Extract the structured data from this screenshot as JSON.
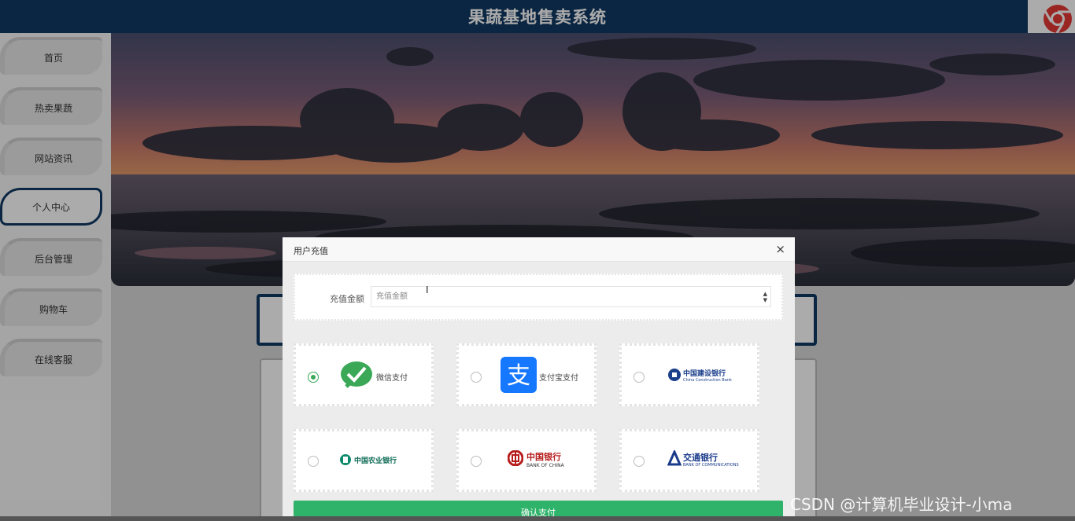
{
  "header": {
    "title": "果蔬基地售卖系统"
  },
  "sidebar": {
    "items": [
      {
        "label": "首页"
      },
      {
        "label": "热卖果蔬"
      },
      {
        "label": "网站资讯"
      },
      {
        "label": "个人中心",
        "active": true
      },
      {
        "label": "后台管理"
      },
      {
        "label": "购物车"
      },
      {
        "label": "在线客服"
      }
    ]
  },
  "modal": {
    "title": "用户充值",
    "close_icon": "×",
    "amount_label": "充值金额",
    "amount_placeholder": "充值金额",
    "payment_methods": [
      {
        "label": "微信支付",
        "icon": "wechat-pay-icon",
        "selected": true
      },
      {
        "label": "支付宝支付",
        "icon": "alipay-icon",
        "selected": false
      },
      {
        "label": "中国建设银行",
        "sublabel": "China Construction Bank",
        "icon": "ccb-icon",
        "selected": false
      },
      {
        "label": "中国农业银行",
        "icon": "abc-icon",
        "selected": false
      },
      {
        "label": "中国银行",
        "sublabel": "BANK OF CHINA",
        "icon": "boc-icon",
        "selected": false
      },
      {
        "label": "交通银行",
        "sublabel": "BANK OF COMMUNICATIONS",
        "icon": "bocom-icon",
        "selected": false
      }
    ],
    "confirm_label": "确认支付"
  },
  "watermark": "CSDN @计算机毕业设计-小ma",
  "colors": {
    "primary": "#113a63",
    "confirm": "#2fb36a",
    "wechat": "#3aa856",
    "alipay": "#1677ff"
  }
}
